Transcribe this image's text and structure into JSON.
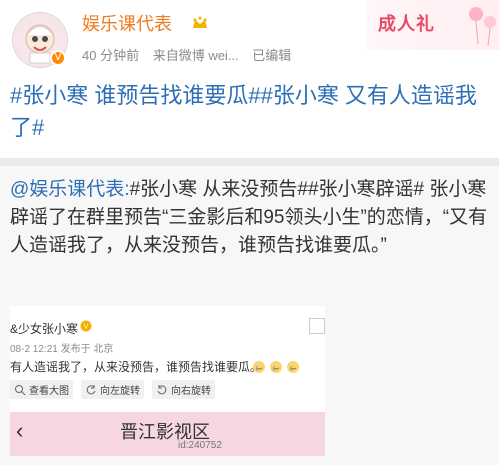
{
  "header": {
    "username": "娱乐课代表",
    "meta": [
      "40 分钟前",
      "来自微博 wei...",
      "已编辑"
    ],
    "badge": "成人礼"
  },
  "post": {
    "title": "#张小寒 谁预告找谁要瓜##张小寒 又有人造谣我了#"
  },
  "repost": {
    "author": "@娱乐课代表:",
    "text": "#张小寒 从来没预告##张小寒辟谣# 张小寒辟谣了在群里预告“三金影后和95领头小生”的恋情，“又有人造谣我了，从来没预告，谁预告找谁要瓜。”"
  },
  "embed": {
    "name": "&少女张小寒",
    "meta": "08-2 12:21 发布于 北京",
    "body": "有人造谣我了，从来没预告，谁预告找谁要瓜。",
    "tools": [
      "查看大图",
      "向左旋转",
      "向右旋转"
    ],
    "bar_title": "晋江影视区",
    "bar_id": "id:240752"
  }
}
